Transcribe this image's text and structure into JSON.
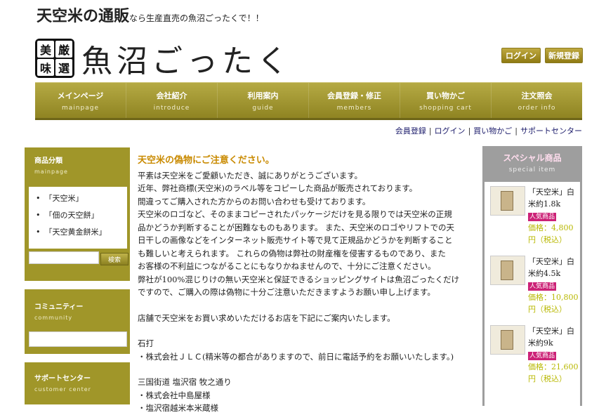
{
  "header": {
    "tagline_bold": "天空米の通販",
    "tagline_rest": "なら生産直売の魚沼ごったくで！！",
    "logo_seal": [
      "美",
      "厳",
      "味",
      "選"
    ],
    "logo_text": "魚沼ごったく",
    "login_label": "ログイン",
    "register_label": "新規登録"
  },
  "nav": [
    {
      "jp": "メインページ",
      "en": "mainpage"
    },
    {
      "jp": "会社紹介",
      "en": "introduce"
    },
    {
      "jp": "利用案内",
      "en": "guide"
    },
    {
      "jp": "会員登録・修正",
      "en": "members"
    },
    {
      "jp": "買い物かご",
      "en": "shopping cart"
    },
    {
      "jp": "注文照会",
      "en": "order info"
    }
  ],
  "sublinks": [
    "会員登録",
    "ログイン",
    "買い物かご",
    "サポートセンター"
  ],
  "sidebar": {
    "category": {
      "title": "商品分類",
      "subtitle": "mainpage",
      "items": [
        "「天空米」",
        "「佃の天空餅」",
        "「天空黄金餅米」"
      ],
      "search_label": "検索"
    },
    "community": {
      "title": "コミュニティー",
      "subtitle": "community"
    },
    "support": {
      "title": "サポートセンター",
      "subtitle": "customer center"
    }
  },
  "main": {
    "heading": "天空米の偽物にご注意ください。",
    "lines": [
      "平素は天空米をご愛顧いただき、誠にありがとうございます。",
      "近年、弊社商標(天空米)のラベル等をコピーした商品が販売されております。",
      "間違ってご購入された方からのお問い合わせも受けております。",
      "天空米のロゴなど、そのままコピーされたパッケージだけを見る限りでは天空米の正規",
      "品かどうか判断することが困難なものもあります。 また、天空米のロゴやリフトでの天",
      "日干しの画像などをインターネット販売サイト等で見て正規品かどうかを判断すること",
      "も難しいと考えられます。 これらの偽物は弊社の財産権を侵害するものであり、また",
      "お客様の不利益につながることにもなりかねませんので、十分にご注意ください。",
      "弊社が100%混じりけの無い天空米と保証できるショッピングサイトは魚沼ごったくだけ",
      "ですので、ご購入の際は偽物に十分ご注意いただきますようお願い申し上げます。"
    ],
    "store_intro": "店舗で天空米をお買い求めいただけるお店を下記にご案内いたします。",
    "store_area_1": "石打",
    "store_1": "・株式会社ＪＬＣ(精米等の都合がありますので、前日に電話予約をお願いいたします。)",
    "store_area_2": "三国街道 塩沢宿 牧之通り",
    "store_2": "・株式会社中島屋様",
    "store_3": "・塩沢宿越米本米蔵様"
  },
  "special": {
    "title": "スペシャル商品",
    "subtitle": "special item",
    "products": [
      {
        "name": "「天空米」白米約1.8k",
        "badge": "人気商品",
        "price": "価格：4,800円（税込）"
      },
      {
        "name": "「天空米」白米約4.5k",
        "badge": "人気商品",
        "price": "価格：10,800円（税込）"
      },
      {
        "name": "「天空米」白米約9k",
        "badge": "人気商品",
        "price": "価格：21,600円（税込）"
      }
    ]
  }
}
